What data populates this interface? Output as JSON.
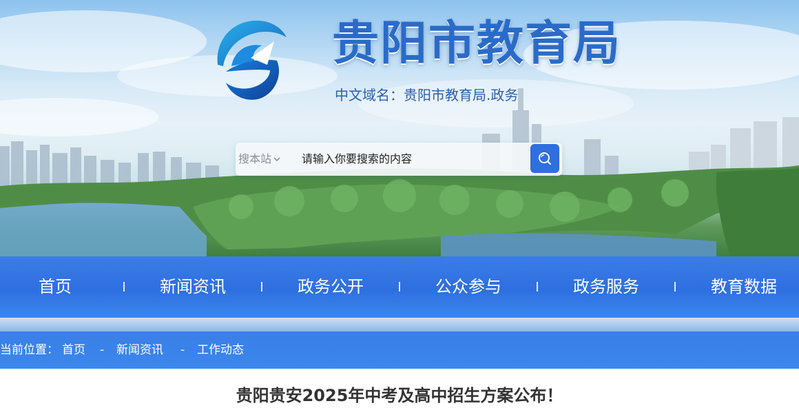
{
  "header": {
    "site_title": "贵阳市教育局",
    "domain_label": "中文域名：",
    "domain_value": "贵阳市教育局.政务"
  },
  "search": {
    "scope_label": "搜本站",
    "placeholder": "请输入你要搜索的内容",
    "button_icon": "search-icon"
  },
  "nav": {
    "items": [
      {
        "label": "首页"
      },
      {
        "label": "新闻资讯"
      },
      {
        "label": "政务公开"
      },
      {
        "label": "公众参与"
      },
      {
        "label": "政务服务"
      },
      {
        "label": "教育数据"
      }
    ]
  },
  "breadcrumb": {
    "prefix": "当前位置：",
    "separator": "-",
    "items": [
      {
        "label": "首页"
      },
      {
        "label": "新闻资讯"
      },
      {
        "label": "工作动态"
      }
    ]
  },
  "article": {
    "title": "贵阳贵安2025年中考及高中招生方案公布！"
  },
  "colors": {
    "brand_blue": "#2f6fdf",
    "title_blue": "#2a6bc9",
    "nav_bg": "#2e6fe0"
  }
}
